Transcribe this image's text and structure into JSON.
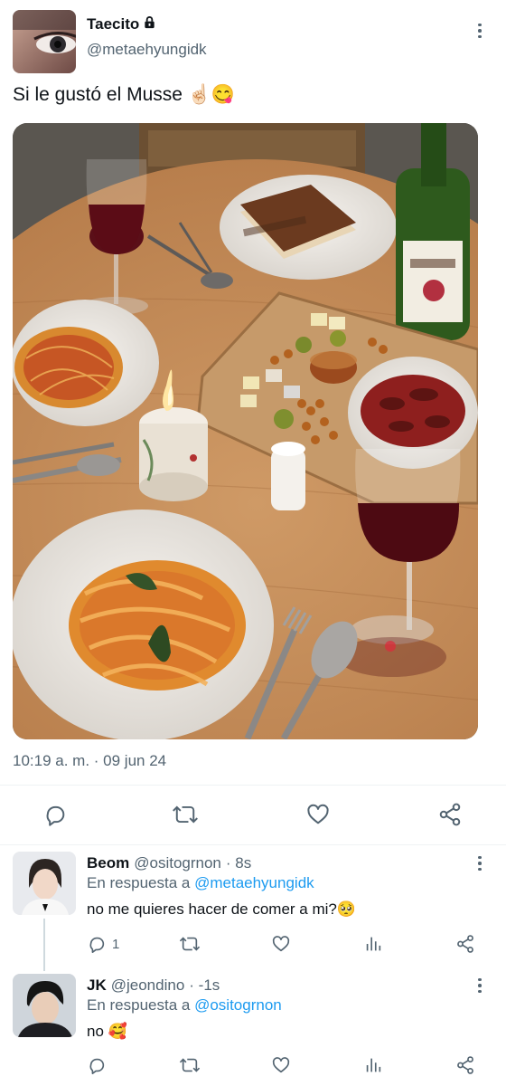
{
  "tweet": {
    "author_name": "Taecito",
    "author_handle": "@metaehyungidk",
    "text": "Si le gustó el Musse ☝🏻😋",
    "timestamp": "10:19 a. m. · 09 jun 24",
    "locked_icon": "lock-icon"
  },
  "replies": [
    {
      "name": "Beom",
      "handle": "@ositogrnon",
      "time": "· 8s",
      "reply_prefix": "En respuesta a",
      "reply_to": "@metaehyungidk",
      "text": "no me quieres hacer de comer a mi?🥺",
      "reply_count": "1"
    },
    {
      "name": "JK",
      "handle": "@jeondino",
      "time": "· -1s",
      "reply_prefix": "En respuesta a",
      "reply_to": "@ositogrnon",
      "text": "no 🥰",
      "reply_count": ""
    }
  ],
  "colors": {
    "accent": "#1d9bf0",
    "muted": "#536471",
    "divider": "#eff3f4"
  }
}
